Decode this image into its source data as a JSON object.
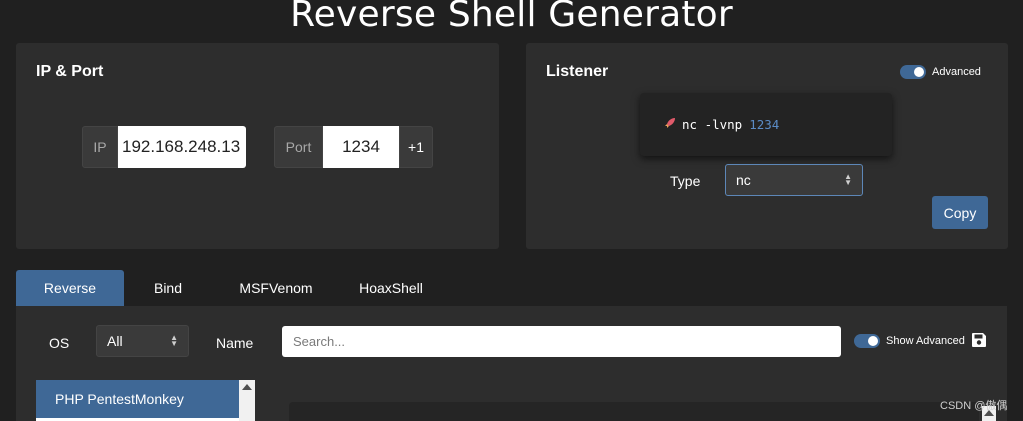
{
  "page": {
    "title": "Reverse Shell Generator"
  },
  "ip_port": {
    "title": "IP & Port",
    "ip_label": "IP",
    "ip_value": "192.168.248.13",
    "port_label": "Port",
    "port_value": "1234",
    "increment_label": "+1"
  },
  "listener": {
    "title": "Listener",
    "advanced_label": "Advanced",
    "advanced_on": true,
    "command": "nc -lvnp",
    "command_port": "1234",
    "type_label": "Type",
    "type_value": "nc",
    "copy_label": "Copy"
  },
  "tabs": [
    {
      "label": "Reverse",
      "active": true
    },
    {
      "label": "Bind",
      "active": false
    },
    {
      "label": "MSFVenom",
      "active": false
    },
    {
      "label": "HoaxShell",
      "active": false
    }
  ],
  "filters": {
    "os_label": "OS",
    "os_value": "All",
    "name_label": "Name",
    "search_placeholder": "Search...",
    "show_advanced_label": "Show Advanced",
    "show_advanced_on": true
  },
  "shell_list": {
    "items": [
      "PHP PentestMonkey"
    ]
  },
  "watermark": "CSDN @傲偶",
  "colors": {
    "accent": "#3f6896",
    "background": "#202020",
    "card": "#2d2d2d"
  },
  "icons": {
    "command_icon": "rocket-icon",
    "save": "save-icon",
    "select_caret": "chevron-updown-icon"
  }
}
